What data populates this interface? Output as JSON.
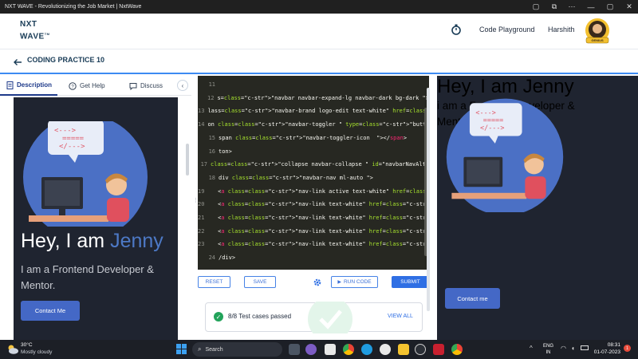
{
  "window": {
    "title": "NXT WAVE - Revolutionizing the Job Market | NxtWave"
  },
  "header": {
    "logo_line1": "NXT",
    "logo_line2": "WAVE",
    "logo_tm": "TM",
    "nav_code_playground": "Code Playground",
    "user_name": "Harshith",
    "avatar_badge": "GENIUS"
  },
  "subheader": {
    "back_icon": "arrow-left-icon",
    "title": "CODING PRACTICE 10"
  },
  "left_tabs": [
    {
      "label": "Description",
      "icon": "document-icon",
      "active": true
    },
    {
      "label": "Get Help",
      "icon": "help-circle-icon",
      "active": false
    },
    {
      "label": "Discuss",
      "icon": "chat-icon",
      "active": false
    }
  ],
  "preview_left": {
    "greeting": "Hey, I am ",
    "name": "Jenny",
    "role": "I am a Frontend Developer & Mentor.",
    "button": "Contact Me"
  },
  "preview_right": {
    "greeting": "Hey, I am ",
    "name": "Jenny",
    "role": "i am a Frontend Developer & Mentor.",
    "button": "Contact me"
  },
  "editor": {
    "lines": [
      {
        "num": "11",
        "text": ""
      },
      {
        "num": "12",
        "text": "s=\"navbar navbar-expand-lg navbar-dark bg-dark \">"
      },
      {
        "num": "13",
        "text": "lass=\"navbar-brand logo-edit text-white\" href=\"#\">J."
      },
      {
        "num": "14",
        "text": "on class=\"navbar-toggler \" type=\"button \" data-togg"
      },
      {
        "num": "15",
        "text": "span class=\"navbar-toggler-icon  \"></span>"
      },
      {
        "num": "16",
        "text": "ton>"
      },
      {
        "num": "17",
        "text": "class=\"collapse navbar-collapse \" id=\"navbarNavAltM"
      },
      {
        "num": "18",
        "text": "div class=\"navbar-nav ml-auto \">"
      },
      {
        "num": "19",
        "text": "   <a class=\"nav-link active text-white\" href=\"#\">H"
      },
      {
        "num": "20",
        "text": "   <a class=\"nav-link text-white\" href=\"#\">About me"
      },
      {
        "num": "21",
        "text": "   <a class=\"nav-link text-white\" href=\"#\">Projects"
      },
      {
        "num": "22",
        "text": "   <a class=\"nav-link text-white\" href=\"#\">Recent B"
      },
      {
        "num": "23",
        "text": "   <a class=\"nav-link text-white\" href=\"#\">Testimon"
      },
      {
        "num": "24",
        "text": "/div>"
      }
    ]
  },
  "actions": {
    "reset": "RESET",
    "save": "SAVE",
    "settings_icon": "gear-icon",
    "run_code": "RUN CODE",
    "submit": "SUBMIT"
  },
  "tests": {
    "summary": "8/8 Test cases passed",
    "view_all": "VIEW ALL"
  },
  "taskbar": {
    "weather_temp": "30°C",
    "weather_desc": "Mostly cloudy",
    "search_placeholder": "Search",
    "lang_line1": "ENG",
    "lang_line2": "IN",
    "time": "08:31",
    "date": "01-07-2023"
  },
  "colors": {
    "accent": "#3d8bf2",
    "brand_dark": "#183b56",
    "preview_bg": "#1f2430",
    "name_blue": "#4d79c6",
    "editor_bg": "#272822"
  }
}
